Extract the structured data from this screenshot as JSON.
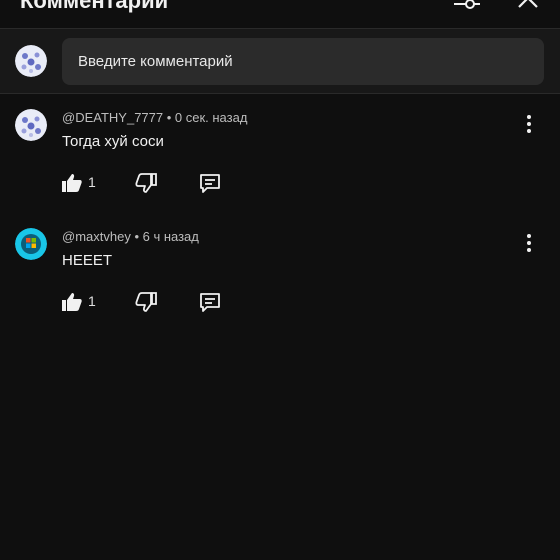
{
  "header": {
    "title": "Комментарии",
    "caret_icon": "caret-down-icon",
    "filter_icon": "sort-filter-icon",
    "close_icon": "close-icon"
  },
  "composer": {
    "placeholder": "Введите комментарий",
    "avatar_icon": "user-avatar-icon"
  },
  "comments": [
    {
      "author": "@DEATHY_7777",
      "time": "0 сек. назад",
      "meta": "@DEATHY_7777 • 0 сек. назад",
      "text": "Тогда хуй соси",
      "likes": "1",
      "avatar_icon": "user-avatar-icon"
    },
    {
      "author": "@maxtvhey",
      "time": "6 ч назад",
      "meta": "@maxtvhey • 6 ч назад",
      "text": "НЕЕЕТ",
      "likes": "1",
      "avatar_icon": "user-avatar-icon"
    }
  ],
  "colors": {
    "background": "#0f0f0f",
    "composer_bg": "#181818",
    "input_bg": "#2b2b2b",
    "text": "#f1f1f1",
    "meta": "#bdbdbd"
  }
}
